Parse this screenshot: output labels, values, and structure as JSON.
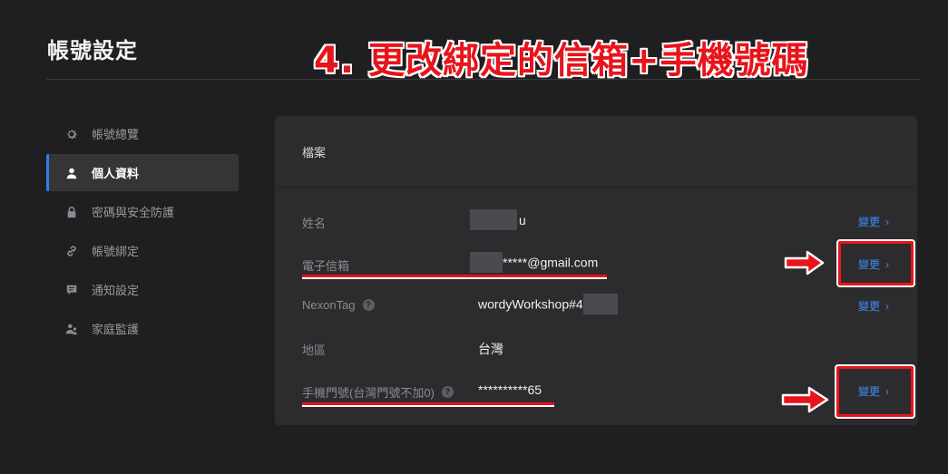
{
  "page": {
    "title": "帳號設定"
  },
  "annotation": {
    "text": "4. 更改綁定的信箱+手機號碼"
  },
  "sidebar": {
    "items": [
      {
        "label": "帳號總覽",
        "icon": "gear-icon"
      },
      {
        "label": "個人資料",
        "icon": "person-icon",
        "active": true
      },
      {
        "label": "密碼與安全防護",
        "icon": "lock-icon"
      },
      {
        "label": "帳號綁定",
        "icon": "link-icon"
      },
      {
        "label": "通知設定",
        "icon": "message-icon"
      },
      {
        "label": "家庭監護",
        "icon": "family-icon"
      }
    ]
  },
  "profile": {
    "header": "檔案",
    "rows": [
      {
        "label": "姓名",
        "value_suffix": "u",
        "change": "變更"
      },
      {
        "label": "電子信箱",
        "value_suffix": "*****@gmail.com",
        "change": "變更"
      },
      {
        "label": "NexonTag",
        "help": "?",
        "value_prefix": "wordyWorkshop#4",
        "change": "變更"
      },
      {
        "label": "地區",
        "value": "台灣"
      },
      {
        "label": "手機門號(台灣門號不加0)",
        "help": "?",
        "value": "**********65",
        "change": "變更"
      }
    ]
  },
  "colors": {
    "accent": "#2f7df0",
    "link": "#3d8df6",
    "annotation": "#e8141b",
    "background": "#1f1f21",
    "panel": "#2c2c2f"
  }
}
